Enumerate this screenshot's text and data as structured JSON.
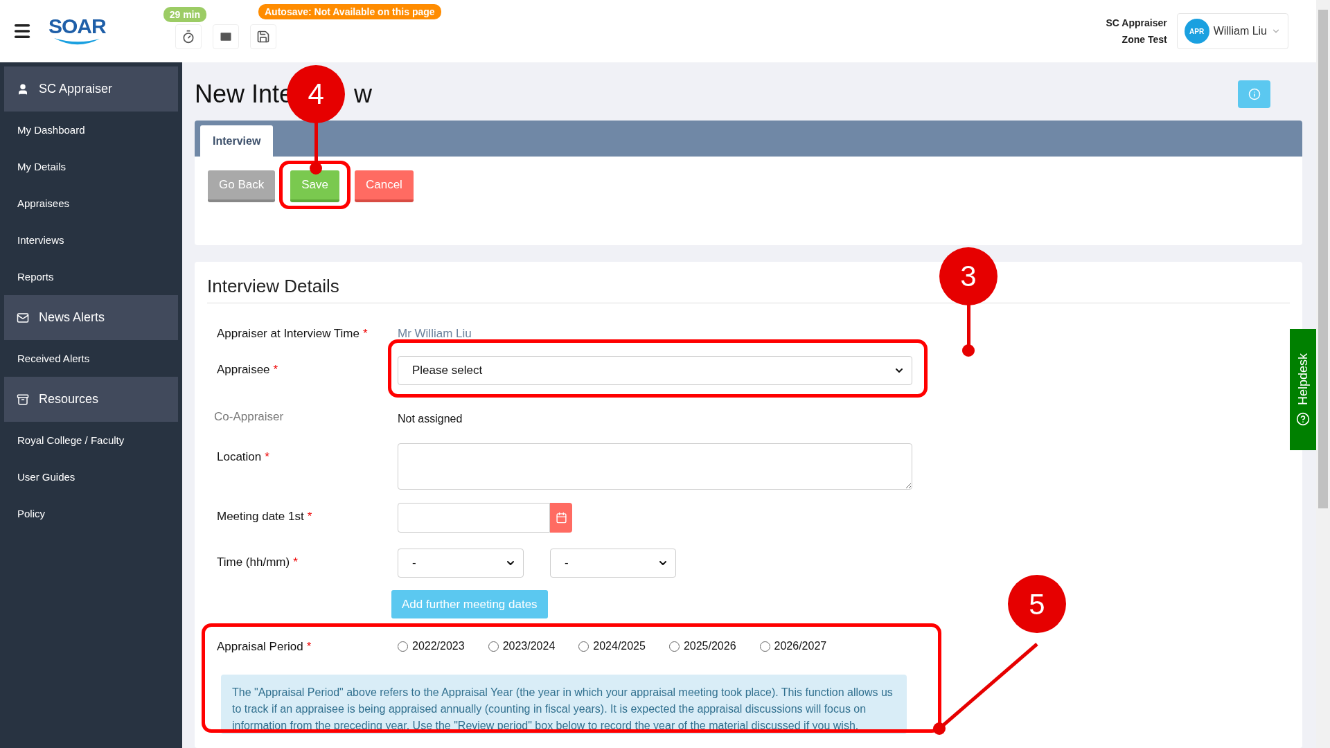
{
  "header": {
    "logo": "SOAR",
    "timer_badge": "29 min",
    "autosave_badge": "Autosave: Not Available on this page",
    "role_lines": [
      "SC Appraiser",
      "Zone Test"
    ],
    "user": {
      "initials": "APR",
      "name": "William Liu"
    }
  },
  "sidebar": {
    "sections": [
      {
        "title": "SC Appraiser",
        "items": [
          "My Dashboard",
          "My Details",
          "Appraisees",
          "Interviews",
          "Reports"
        ]
      },
      {
        "title": "News Alerts",
        "items": [
          "Received Alerts"
        ]
      },
      {
        "title": "Resources",
        "items": [
          "Royal College / Faculty",
          "User Guides",
          "Policy"
        ]
      }
    ]
  },
  "page": {
    "title_parts": [
      "New Inte",
      "w"
    ]
  },
  "tabs": [
    {
      "label": "Interview",
      "selected": true
    }
  ],
  "buttons": [
    {
      "label": "Go Back",
      "kind": "default"
    },
    {
      "label": "Save",
      "kind": "success"
    },
    {
      "label": "Cancel",
      "kind": "danger"
    }
  ],
  "details": {
    "heading": "Interview Details",
    "fields": [
      {
        "kind": "static",
        "label": "Appraiser at Interview Time",
        "mark": "*",
        "value": "Mr William Liu"
      },
      {
        "kind": "select",
        "label": "Appraisee",
        "mark": "*",
        "value": "Please select"
      },
      {
        "kind": "text",
        "label": "Co-Appraiser",
        "value": "Not assigned"
      },
      {
        "kind": "textarea",
        "label": "Location",
        "mark": "*"
      },
      {
        "kind": "date",
        "label": "Meeting date 1st",
        "mark": "*"
      },
      {
        "kind": "time",
        "label": "Time (hh/mm)",
        "mark": "*",
        "values": [
          "-",
          "-"
        ]
      }
    ],
    "add_button": "Add further meeting dates",
    "period": {
      "label": "Appraisal Period",
      "mark": "*",
      "options": [
        {
          "label": "2022/2023",
          "selected": false
        },
        {
          "label": "2023/2024",
          "selected": false
        },
        {
          "label": "2024/2025",
          "selected": false
        },
        {
          "label": "2025/2026",
          "selected": false
        },
        {
          "label": "2026/2027",
          "selected": false
        }
      ]
    },
    "note": "The \"Appraisal Period\" above refers to the Appraisal Year (the year in which your appraisal meeting took place). This function allows us to track if an appraisee is being appraised annually (counting in fiscal years). It is expected the appraisal discussions will focus on information from the preceding year. Use the \"Review period\" box below to record the year of the material discussed if you wish."
  },
  "helpdesk": "Helpdesk",
  "callouts": {
    "save": "4",
    "appraisee": "3",
    "period": "5"
  }
}
